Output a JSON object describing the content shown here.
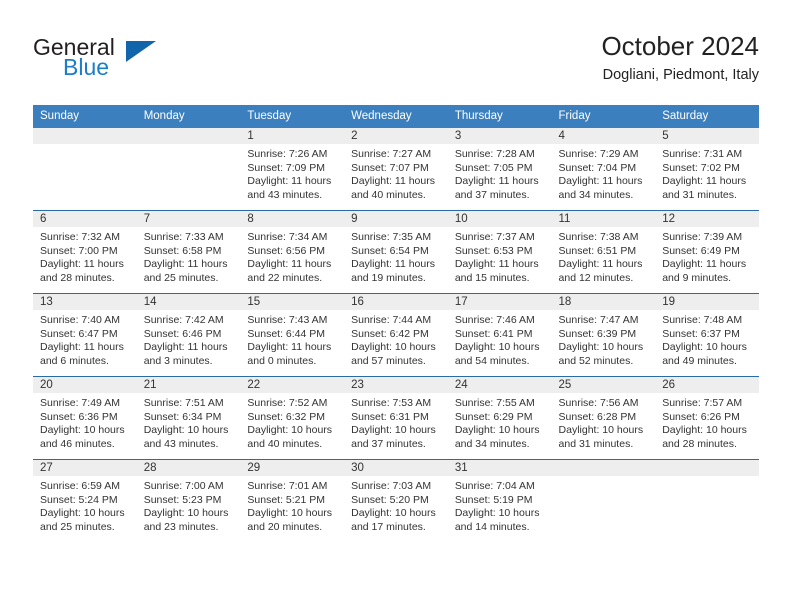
{
  "brand": {
    "name_part1": "General",
    "name_part2": "Blue",
    "triangle_icon": "triangle-icon",
    "color_dark": "#231f20",
    "color_blue": "#1a7ec8",
    "color_triangle": "#1165ab"
  },
  "header": {
    "title": "October 2024",
    "subtitle": "Dogliani, Piedmont, Italy"
  },
  "theme": {
    "header_bg": "#3b7fbe",
    "row_divider": "#2a6aa8",
    "daynum_bg": "#eeeeee",
    "text": "#333333"
  },
  "calendar": {
    "weekdays": [
      "Sunday",
      "Monday",
      "Tuesday",
      "Wednesday",
      "Thursday",
      "Friday",
      "Saturday"
    ],
    "weeks": [
      [
        {
          "day": "",
          "blank": true
        },
        {
          "day": "",
          "blank": true
        },
        {
          "day": "1",
          "sunrise": "Sunrise: 7:26 AM",
          "sunset": "Sunset: 7:09 PM",
          "daylight": "Daylight: 11 hours and 43 minutes."
        },
        {
          "day": "2",
          "sunrise": "Sunrise: 7:27 AM",
          "sunset": "Sunset: 7:07 PM",
          "daylight": "Daylight: 11 hours and 40 minutes."
        },
        {
          "day": "3",
          "sunrise": "Sunrise: 7:28 AM",
          "sunset": "Sunset: 7:05 PM",
          "daylight": "Daylight: 11 hours and 37 minutes."
        },
        {
          "day": "4",
          "sunrise": "Sunrise: 7:29 AM",
          "sunset": "Sunset: 7:04 PM",
          "daylight": "Daylight: 11 hours and 34 minutes."
        },
        {
          "day": "5",
          "sunrise": "Sunrise: 7:31 AM",
          "sunset": "Sunset: 7:02 PM",
          "daylight": "Daylight: 11 hours and 31 minutes."
        }
      ],
      [
        {
          "day": "6",
          "sunrise": "Sunrise: 7:32 AM",
          "sunset": "Sunset: 7:00 PM",
          "daylight": "Daylight: 11 hours and 28 minutes."
        },
        {
          "day": "7",
          "sunrise": "Sunrise: 7:33 AM",
          "sunset": "Sunset: 6:58 PM",
          "daylight": "Daylight: 11 hours and 25 minutes."
        },
        {
          "day": "8",
          "sunrise": "Sunrise: 7:34 AM",
          "sunset": "Sunset: 6:56 PM",
          "daylight": "Daylight: 11 hours and 22 minutes."
        },
        {
          "day": "9",
          "sunrise": "Sunrise: 7:35 AM",
          "sunset": "Sunset: 6:54 PM",
          "daylight": "Daylight: 11 hours and 19 minutes."
        },
        {
          "day": "10",
          "sunrise": "Sunrise: 7:37 AM",
          "sunset": "Sunset: 6:53 PM",
          "daylight": "Daylight: 11 hours and 15 minutes."
        },
        {
          "day": "11",
          "sunrise": "Sunrise: 7:38 AM",
          "sunset": "Sunset: 6:51 PM",
          "daylight": "Daylight: 11 hours and 12 minutes."
        },
        {
          "day": "12",
          "sunrise": "Sunrise: 7:39 AM",
          "sunset": "Sunset: 6:49 PM",
          "daylight": "Daylight: 11 hours and 9 minutes."
        }
      ],
      [
        {
          "day": "13",
          "sunrise": "Sunrise: 7:40 AM",
          "sunset": "Sunset: 6:47 PM",
          "daylight": "Daylight: 11 hours and 6 minutes."
        },
        {
          "day": "14",
          "sunrise": "Sunrise: 7:42 AM",
          "sunset": "Sunset: 6:46 PM",
          "daylight": "Daylight: 11 hours and 3 minutes."
        },
        {
          "day": "15",
          "sunrise": "Sunrise: 7:43 AM",
          "sunset": "Sunset: 6:44 PM",
          "daylight": "Daylight: 11 hours and 0 minutes."
        },
        {
          "day": "16",
          "sunrise": "Sunrise: 7:44 AM",
          "sunset": "Sunset: 6:42 PM",
          "daylight": "Daylight: 10 hours and 57 minutes."
        },
        {
          "day": "17",
          "sunrise": "Sunrise: 7:46 AM",
          "sunset": "Sunset: 6:41 PM",
          "daylight": "Daylight: 10 hours and 54 minutes."
        },
        {
          "day": "18",
          "sunrise": "Sunrise: 7:47 AM",
          "sunset": "Sunset: 6:39 PM",
          "daylight": "Daylight: 10 hours and 52 minutes."
        },
        {
          "day": "19",
          "sunrise": "Sunrise: 7:48 AM",
          "sunset": "Sunset: 6:37 PM",
          "daylight": "Daylight: 10 hours and 49 minutes."
        }
      ],
      [
        {
          "day": "20",
          "sunrise": "Sunrise: 7:49 AM",
          "sunset": "Sunset: 6:36 PM",
          "daylight": "Daylight: 10 hours and 46 minutes."
        },
        {
          "day": "21",
          "sunrise": "Sunrise: 7:51 AM",
          "sunset": "Sunset: 6:34 PM",
          "daylight": "Daylight: 10 hours and 43 minutes."
        },
        {
          "day": "22",
          "sunrise": "Sunrise: 7:52 AM",
          "sunset": "Sunset: 6:32 PM",
          "daylight": "Daylight: 10 hours and 40 minutes."
        },
        {
          "day": "23",
          "sunrise": "Sunrise: 7:53 AM",
          "sunset": "Sunset: 6:31 PM",
          "daylight": "Daylight: 10 hours and 37 minutes."
        },
        {
          "day": "24",
          "sunrise": "Sunrise: 7:55 AM",
          "sunset": "Sunset: 6:29 PM",
          "daylight": "Daylight: 10 hours and 34 minutes."
        },
        {
          "day": "25",
          "sunrise": "Sunrise: 7:56 AM",
          "sunset": "Sunset: 6:28 PM",
          "daylight": "Daylight: 10 hours and 31 minutes."
        },
        {
          "day": "26",
          "sunrise": "Sunrise: 7:57 AM",
          "sunset": "Sunset: 6:26 PM",
          "daylight": "Daylight: 10 hours and 28 minutes."
        }
      ],
      [
        {
          "day": "27",
          "sunrise": "Sunrise: 6:59 AM",
          "sunset": "Sunset: 5:24 PM",
          "daylight": "Daylight: 10 hours and 25 minutes."
        },
        {
          "day": "28",
          "sunrise": "Sunrise: 7:00 AM",
          "sunset": "Sunset: 5:23 PM",
          "daylight": "Daylight: 10 hours and 23 minutes."
        },
        {
          "day": "29",
          "sunrise": "Sunrise: 7:01 AM",
          "sunset": "Sunset: 5:21 PM",
          "daylight": "Daylight: 10 hours and 20 minutes."
        },
        {
          "day": "30",
          "sunrise": "Sunrise: 7:03 AM",
          "sunset": "Sunset: 5:20 PM",
          "daylight": "Daylight: 10 hours and 17 minutes."
        },
        {
          "day": "31",
          "sunrise": "Sunrise: 7:04 AM",
          "sunset": "Sunset: 5:19 PM",
          "daylight": "Daylight: 10 hours and 14 minutes."
        },
        {
          "day": "",
          "blank": true
        },
        {
          "day": "",
          "blank": true
        }
      ]
    ]
  }
}
